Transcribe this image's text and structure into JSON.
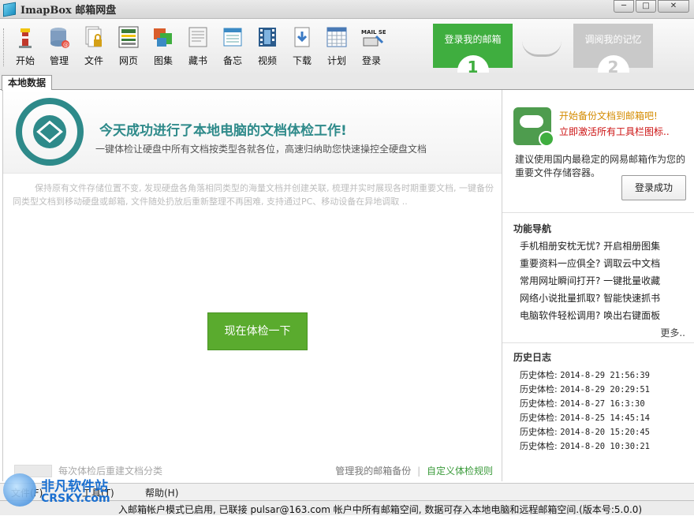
{
  "app": {
    "title": "ImapBox 邮箱网盘"
  },
  "window_controls": [
    "─",
    "□",
    "✕"
  ],
  "toolbar": {
    "items": [
      {
        "label": "开始",
        "icon": "lighthouse-icon",
        "color": "#c0392b"
      },
      {
        "label": "管理",
        "icon": "database-icon",
        "color": "#6c8fb5"
      },
      {
        "label": "文件",
        "icon": "file-lock-icon",
        "color": "#e2d27a"
      },
      {
        "label": "网页",
        "icon": "webpage-icon",
        "color": "#3a7a3a"
      },
      {
        "label": "图集",
        "icon": "gallery-icon",
        "color": "#d95d2b"
      },
      {
        "label": "藏书",
        "icon": "book-icon",
        "color": "#888888"
      },
      {
        "label": "备忘",
        "icon": "memo-icon",
        "color": "#3b8ac4"
      },
      {
        "label": "视频",
        "icon": "video-icon",
        "color": "#2b5b8c"
      },
      {
        "label": "下载",
        "icon": "download-icon",
        "color": "#3b7ac4"
      },
      {
        "label": "计划",
        "icon": "calendar-icon",
        "color": "#4a7ab5"
      },
      {
        "label": "登录",
        "icon": "mail-server-icon",
        "color": "#222222"
      }
    ],
    "mail_server_text": "MAIL SERVER"
  },
  "steps": {
    "step1": {
      "label": "登录我的邮箱",
      "num": "1"
    },
    "step2": {
      "label": "调阅我的记忆",
      "num": "2"
    }
  },
  "tabs": [
    {
      "label": "本地数据"
    }
  ],
  "main": {
    "hero_title": "今天成功进行了本地电脑的文档体检工作!",
    "hero_sub": "一键体检让硬盘中所有文档按类型各就各位，高速归纳助您快速操控全硬盘文档",
    "description": "保持原有文件存储位置不变, 发现硬盘各角落相同类型的海量文档并创建关联, 梳理并实时展现各时期重要文档, 一键备份同类型文档到移动硬盘或邮箱, 文件随处扔放后重新整理不再困难, 支持通过PC、移动设备在异地调取 ..",
    "check_button": "现在体检一下",
    "auto_classify": "每次体检后重建文档分类",
    "link_manage": "管理我的邮箱备份",
    "link_sep": "|",
    "link_custom": "自定义体检规则"
  },
  "side": {
    "promo_line1": "开始备份文档到邮箱吧!",
    "promo_line2": "立即激活所有工具栏图标..",
    "promo_desc": "建议使用国内最稳定的网易邮箱作为您的重要文件存储容器。",
    "login_button": "登录成功",
    "nav_title": "功能导航",
    "nav_items": [
      "手机相册安枕无忧? 开启相册图集",
      "重要资料一应俱全? 调取云中文档",
      "常用网址瞬间打开? 一键批量收藏",
      "网络小说批量抓取? 智能快速抓书",
      "电脑软件轻松调用? 唤出右键面板"
    ],
    "more": "更多..",
    "history_title": "历史日志",
    "history": [
      {
        "label": "历史体检:",
        "time": "2014-8-29 21:56:39"
      },
      {
        "label": "历史体检:",
        "time": "2014-8-29 20:29:51"
      },
      {
        "label": "历史体检:",
        "time": "2014-8-27 16:3:30"
      },
      {
        "label": "历史体检:",
        "time": "2014-8-25 14:45:14"
      },
      {
        "label": "历史体检:",
        "time": "2014-8-20 15:20:45"
      },
      {
        "label": "历史体检:",
        "time": "2014-8-20 10:30:21"
      }
    ]
  },
  "menubar": {
    "items": [
      "文件(F)",
      "工具(T)",
      "帮助(H)"
    ]
  },
  "statusbar": {
    "text": "入邮箱帐户模式已启用, 已联接 pulsar@163.com 帐户中所有邮箱空间, 数据可存入本地电脑和远程邮箱空间.(版本号:5.0.0)"
  },
  "watermark": {
    "line1": "非凡软件站",
    "line2": "CRSKY.com"
  }
}
